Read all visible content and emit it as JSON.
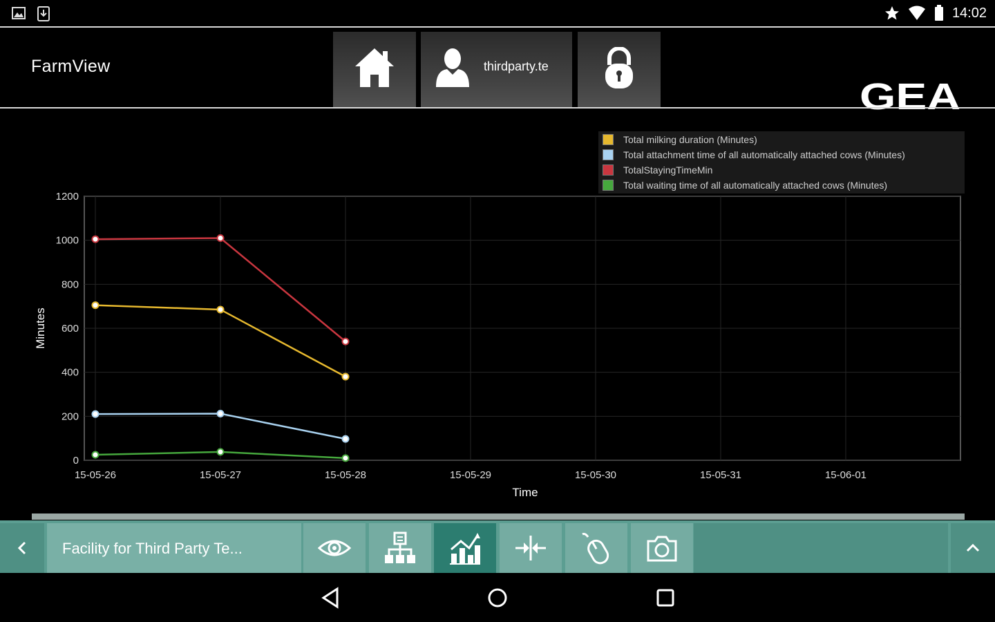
{
  "status_bar": {
    "time": "14:02",
    "left_icons": [
      "image-icon",
      "download-icon"
    ],
    "right_icons": [
      "star-icon",
      "wifi-icon",
      "battery-icon"
    ]
  },
  "header": {
    "app_title": "FarmView",
    "user_label": "thirdparty.te",
    "logo_text": "GEA",
    "buttons": [
      "home-icon",
      "user-icon",
      "lock-icon"
    ]
  },
  "chart_data": {
    "type": "line",
    "xlabel": "Time",
    "ylabel": "Minutes",
    "ylim": [
      0,
      1200
    ],
    "yticks": [
      "0",
      "200",
      "400",
      "600",
      "800",
      "1000",
      "1200"
    ],
    "xticks": [
      "15-05-26",
      "15-05-27",
      "15-05-28",
      "15-05-29",
      "15-05-30",
      "15-05-31",
      "15-06-01"
    ],
    "x": [
      "15-05-26",
      "15-05-27",
      "15-05-28"
    ],
    "grid": true,
    "legend_position": "top-right",
    "series": [
      {
        "name": "Total milking duration (Minutes)",
        "color": "#e6b82e",
        "values": [
          705,
          685,
          380
        ]
      },
      {
        "name": "Total attachment time of all automatically attached cows (Minutes)",
        "color": "#a9d2f0",
        "values": [
          210,
          212,
          97
        ]
      },
      {
        "name": "TotalStayingTimeMin",
        "color": "#c9363f",
        "values": [
          1005,
          1010,
          540
        ]
      },
      {
        "name": "Total waiting time of all automatically attached cows (Minutes)",
        "color": "#46a83d",
        "values": [
          25,
          38,
          10
        ]
      }
    ]
  },
  "toolbar": {
    "title": "Facility for Third Party Te...",
    "buttons": [
      {
        "icon": "eye-icon",
        "active": false
      },
      {
        "icon": "hierarchy-icon",
        "active": false
      },
      {
        "icon": "chart-icon",
        "active": true
      },
      {
        "icon": "split-icon",
        "active": false
      },
      {
        "icon": "mouse-icon",
        "active": false
      },
      {
        "icon": "camera-icon",
        "active": false
      }
    ],
    "accent": "#5c9e92",
    "active_color": "#2c7d70"
  },
  "nav_bar": {
    "buttons": [
      "back-icon",
      "home-circle-icon",
      "recents-icon"
    ]
  }
}
